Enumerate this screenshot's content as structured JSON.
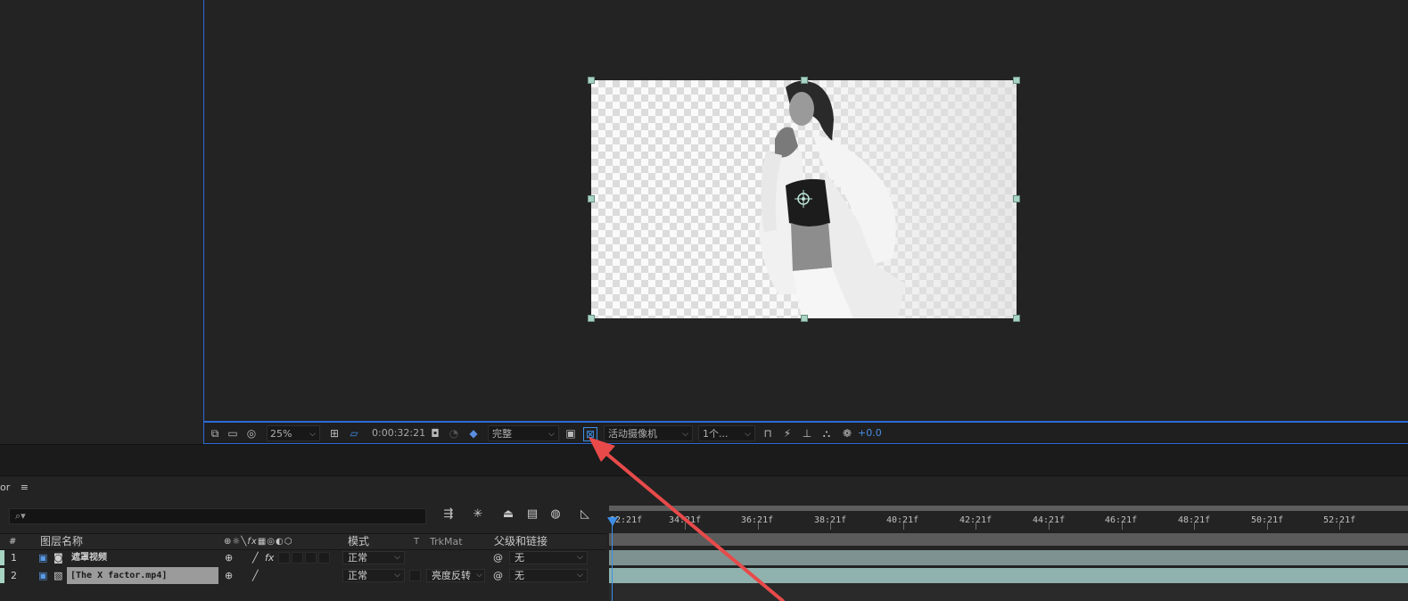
{
  "viewer": {
    "zoom": "25%",
    "timecode": "0:00:32:21",
    "resolution": "完整",
    "camera": "活动摄像机",
    "views": "1个...",
    "exposure": "+0.0"
  },
  "timeline": {
    "tab_fragment": "or",
    "menu_icon": "≡",
    "search_placeholder": "",
    "headers": {
      "num": "#",
      "layer_name": "图层名称",
      "mode": "模式",
      "t": "T",
      "trkmat": "TrkMat",
      "parent": "父级和链接"
    },
    "layers": [
      {
        "num": "1",
        "name": "遮罩视频",
        "mode": "正常",
        "trkmat": "",
        "parent": "无"
      },
      {
        "num": "2",
        "name": "[The X factor.mp4]",
        "mode": "正常",
        "trkmat": "亮度反转",
        "parent": "无"
      }
    ],
    "ruler": [
      "32:21f",
      "34:21f",
      "36:21f",
      "38:21f",
      "40:21f",
      "42:21f",
      "44:21f",
      "46:21f",
      "48:21f",
      "50:21f",
      "52:21f"
    ]
  },
  "colors": {
    "accent_blue": "#2d6bd6",
    "layer_label": "#a7d3c3",
    "arrow_red": "#e84a4a"
  }
}
